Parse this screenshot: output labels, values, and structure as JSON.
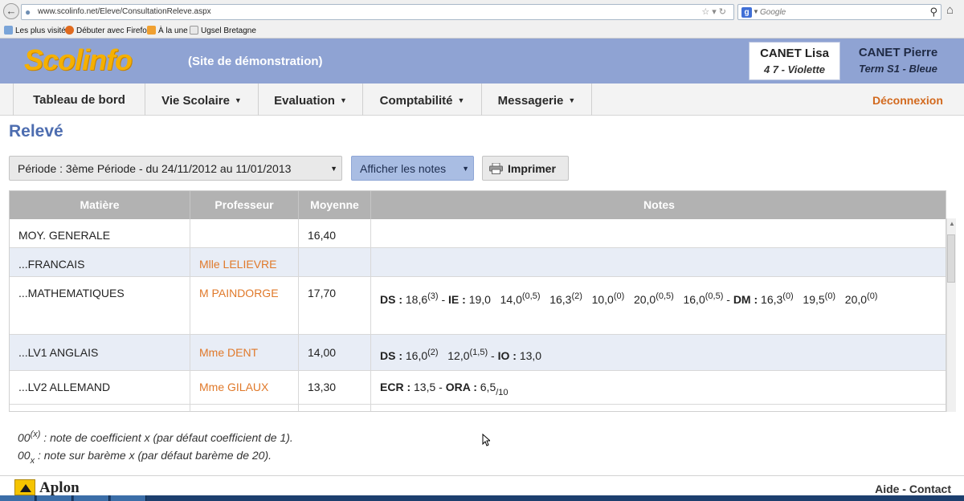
{
  "browser": {
    "url": "www.scolinfo.net/Eleve/ConsultationReleve.aspx",
    "search_placeholder": "Google",
    "bookmarks": [
      "Les plus visités",
      "Débuter avec Firefox",
      "À la une",
      "Ugsel Bretagne"
    ]
  },
  "header": {
    "logo": "Scolinfo",
    "demo_text": "(Site de démonstration)",
    "children": [
      {
        "name": "CANET Lisa",
        "class": "4 7 - Violette",
        "active": true
      },
      {
        "name": "CANET Pierre",
        "class": "Term S1 - Bleue",
        "active": false
      }
    ]
  },
  "nav": {
    "items": [
      "Tableau de bord",
      "Vie Scolaire",
      "Evaluation",
      "Comptabilité",
      "Messagerie"
    ],
    "logout": "Déconnexion"
  },
  "page": {
    "title": "Relevé",
    "period": "Période : 3ème Période - du 24/11/2012 au 11/01/2013",
    "show_notes": "Afficher les notes",
    "print": "Imprimer"
  },
  "table": {
    "headers": [
      "Matière",
      "Professeur",
      "Moyenne",
      "Notes"
    ],
    "rows": [
      {
        "subject": "MOY. GENERALE",
        "teacher": "",
        "average": "16,40",
        "notes": ""
      },
      {
        "subject": "...FRANCAIS",
        "teacher": "Mlle LELIEVRE",
        "average": "",
        "notes": ""
      },
      {
        "subject": "...MATHEMATIQUES",
        "teacher": "M PAINDORGE",
        "average": "17,70",
        "notes": [
          {
            "label": "DS",
            "grades": [
              {
                "v": "18,6",
                "c": "(3)"
              }
            ]
          },
          {
            "label": "IE",
            "grades": [
              {
                "v": "19,0"
              },
              {
                "v": "14,0",
                "c": "(0,5)"
              },
              {
                "v": "16,3",
                "c": "(2)"
              },
              {
                "v": "10,0",
                "c": "(0)"
              },
              {
                "v": "20,0",
                "c": "(0,5)"
              },
              {
                "v": "16,0",
                "c": "(0,5)"
              }
            ]
          },
          {
            "label": "DM",
            "grades": [
              {
                "v": "16,3",
                "c": "(0)"
              },
              {
                "v": "19,5",
                "c": "(0)"
              },
              {
                "v": "20,0",
                "c": "(0)"
              }
            ]
          }
        ]
      },
      {
        "subject": "...LV1 ANGLAIS",
        "teacher": "Mme DENT",
        "average": "14,00",
        "notes": [
          {
            "label": "DS",
            "grades": [
              {
                "v": "16,0",
                "c": "(2)"
              },
              {
                "v": "12,0",
                "c": "(1,5)"
              }
            ]
          },
          {
            "label": "IO",
            "grades": [
              {
                "v": "13,0"
              }
            ]
          }
        ]
      },
      {
        "subject": "...LV2 ALLEMAND",
        "teacher": "Mme GILAUX",
        "average": "13,30",
        "notes": [
          {
            "label": "ECR",
            "grades": [
              {
                "v": "13,5"
              }
            ]
          },
          {
            "label": "ORA",
            "grades": [
              {
                "v": "6,5",
                "b": "/10"
              }
            ]
          }
        ]
      }
    ]
  },
  "legend": {
    "coef_sample": "00",
    "coef_sup": "(x)",
    "coef_text": " : note de coefficient x (par défaut coefficient de 1).",
    "scale_sample": "00",
    "scale_sub": "x",
    "scale_text": " : note sur barème x (par défaut barème de 20)."
  },
  "footer": {
    "brand": "Aplon",
    "help": "Aide",
    "separator": " - ",
    "contact": "Contact"
  },
  "colors": {
    "header_bg": "#8fa3d3",
    "logo": "#f5b000",
    "accent_orange": "#e0792a",
    "title_blue": "#4d6db0",
    "table_header": "#b2b2b2"
  }
}
